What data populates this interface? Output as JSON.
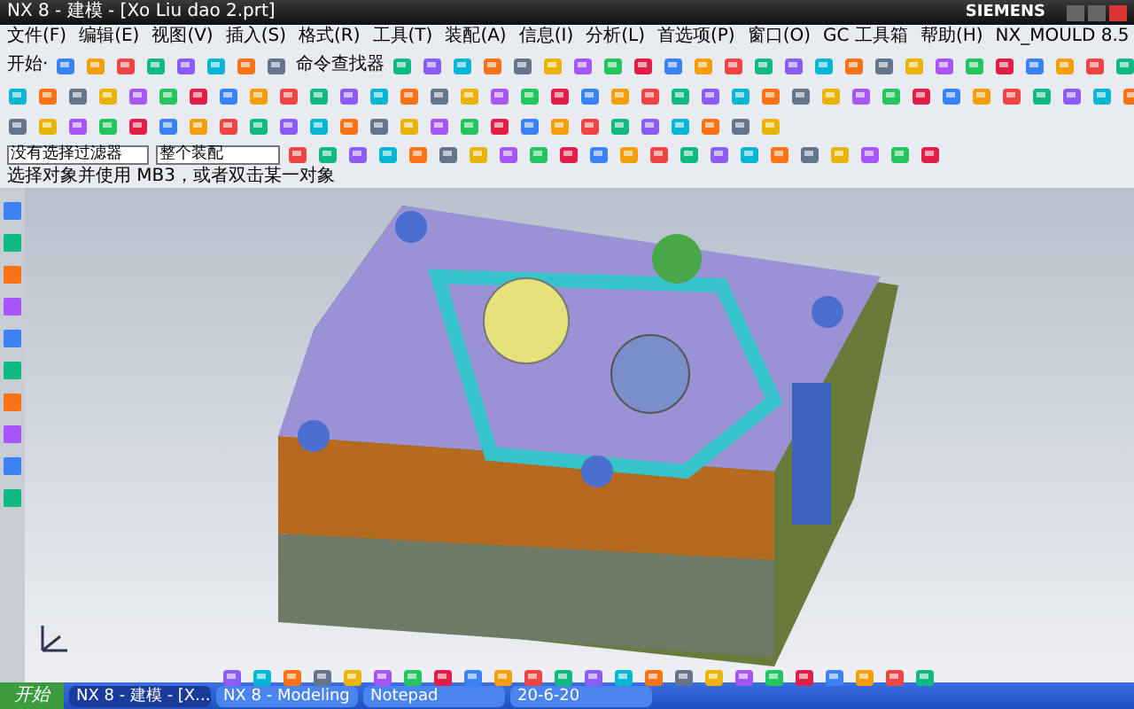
{
  "window": {
    "title": "NX 8 - 建模 - [Xo Liu dao 2.prt]",
    "brand": "SIEMENS"
  },
  "menu": [
    "文件(F)",
    "编辑(E)",
    "视图(V)",
    "插入(S)",
    "格式(R)",
    "工具(T)",
    "装配(A)",
    "信息(I)",
    "分析(L)",
    "首选项(P)",
    "窗口(O)",
    "GC 工具箱",
    "帮助(H)",
    "NX_MOULD 8.5"
  ],
  "toolbar": {
    "start": "开始·",
    "command_finder": "命令查找器"
  },
  "selection_bar": {
    "filter": "没有选择过滤器",
    "scope": "整个装配"
  },
  "status": "选择对象并使用 MB3，或者双击某一对象",
  "taskbar": {
    "start": "开始",
    "tasks": [
      {
        "label": "NX 8 - 建模 - [X...",
        "selected": true
      },
      {
        "label": "NX 8 - Modeling",
        "selected": false
      },
      {
        "label": "Notepad",
        "selected": false
      },
      {
        "label": "20-6-20",
        "selected": false
      }
    ]
  }
}
